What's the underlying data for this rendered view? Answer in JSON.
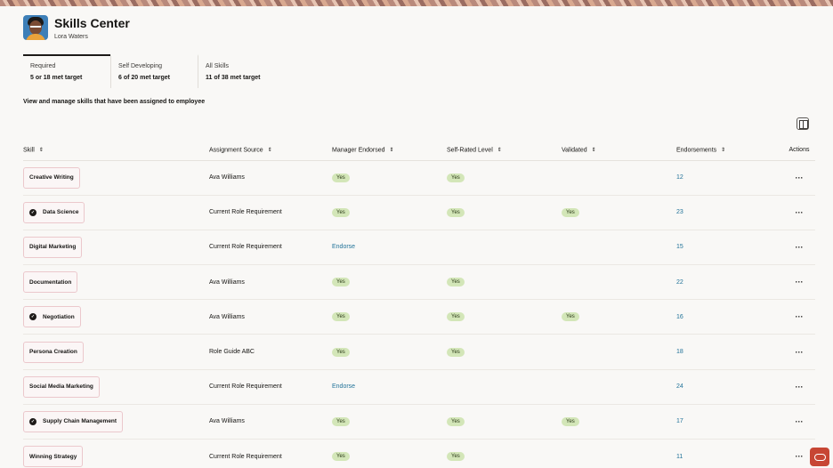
{
  "header": {
    "title": "Skills Center",
    "user_name": "Lora Waters"
  },
  "tabs": [
    {
      "label": "Required",
      "value": "5 or 18 met target",
      "active": true
    },
    {
      "label": "Self Developing",
      "value": "6 of 20 met target",
      "active": false
    },
    {
      "label": "All Skills",
      "value": "11 of 38 met target",
      "active": false
    }
  ],
  "description": "View and manage skills that have been assigned to employee",
  "table": {
    "columns": {
      "skill": "Skill",
      "source": "Assignment Source",
      "manager": "Manager Endorsed",
      "self": "Self-Rated Level",
      "validated": "Validated",
      "endorsements": "Endorsements",
      "actions": "Actions"
    },
    "rows": [
      {
        "skill": "Creative Writing",
        "verified": false,
        "source": "Ava Williams",
        "manager": "Yes",
        "self": "Yes",
        "validated": "",
        "endorsements": "12"
      },
      {
        "skill": "Data Science",
        "verified": true,
        "source": "Current Role Requirement",
        "manager": "Yes",
        "self": "Yes",
        "validated": "Yes",
        "endorsements": "23"
      },
      {
        "skill": "Digital Marketing",
        "verified": false,
        "source": "Current Role Requirement",
        "manager": "Endorse",
        "self": "",
        "validated": "",
        "endorsements": "15"
      },
      {
        "skill": "Documentation",
        "verified": false,
        "source": "Ava Williams",
        "manager": "Yes",
        "self": "Yes",
        "validated": "",
        "endorsements": "22"
      },
      {
        "skill": "Negotiation",
        "verified": true,
        "source": "Ava Williams",
        "manager": "Yes",
        "self": "Yes",
        "validated": "Yes",
        "endorsements": "16"
      },
      {
        "skill": "Persona Creation",
        "verified": false,
        "source": "Role Guide ABC",
        "manager": "Yes",
        "self": "Yes",
        "validated": "",
        "endorsements": "18"
      },
      {
        "skill": "Social Media Marketing",
        "verified": false,
        "source": "Current Role Requirement",
        "manager": "Endorse",
        "self": "",
        "validated": "",
        "endorsements": "24"
      },
      {
        "skill": "Supply Chain Management",
        "verified": true,
        "source": "Ava Williams",
        "manager": "Yes",
        "self": "Yes",
        "validated": "Yes",
        "endorsements": "17"
      },
      {
        "skill": "Winning Strategy",
        "verified": false,
        "source": "Current Role Requirement",
        "manager": "Yes",
        "self": "Yes",
        "validated": "",
        "endorsements": "11"
      }
    ],
    "actions_glyph": "···",
    "sort_glyph": "⇕"
  },
  "icons": {
    "avatar": "user-avatar",
    "verified": "check-badge-icon",
    "panel": "panel-toggle-icon",
    "fab": "oracle-assistant-icon"
  },
  "colors": {
    "accent_link": "#227399",
    "yes_badge": "#d3e6b8",
    "chip_border": "#ebc8cc",
    "fab": "#c74634"
  }
}
